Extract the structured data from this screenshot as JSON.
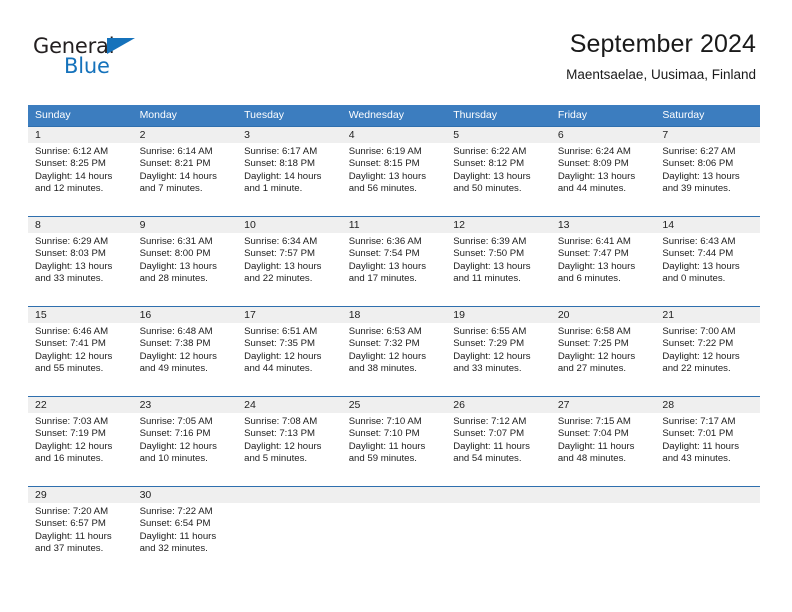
{
  "brand": {
    "word_one": "General",
    "word_two": "Blue",
    "accent_color": "#1572bb"
  },
  "header": {
    "title": "September 2024",
    "subtitle": "Maentsaelae, Uusimaa, Finland"
  },
  "calendar": {
    "header_bg": "#3c7dbf",
    "daynum_bg": "#efefef",
    "weekdays": [
      "Sunday",
      "Monday",
      "Tuesday",
      "Wednesday",
      "Thursday",
      "Friday",
      "Saturday"
    ],
    "weeks": [
      [
        {
          "day": "1",
          "sunrise": "Sunrise: 6:12 AM",
          "sunset": "Sunset: 8:25 PM",
          "daylight1": "Daylight: 14 hours",
          "daylight2": "and 12 minutes."
        },
        {
          "day": "2",
          "sunrise": "Sunrise: 6:14 AM",
          "sunset": "Sunset: 8:21 PM",
          "daylight1": "Daylight: 14 hours",
          "daylight2": "and 7 minutes."
        },
        {
          "day": "3",
          "sunrise": "Sunrise: 6:17 AM",
          "sunset": "Sunset: 8:18 PM",
          "daylight1": "Daylight: 14 hours",
          "daylight2": "and 1 minute."
        },
        {
          "day": "4",
          "sunrise": "Sunrise: 6:19 AM",
          "sunset": "Sunset: 8:15 PM",
          "daylight1": "Daylight: 13 hours",
          "daylight2": "and 56 minutes."
        },
        {
          "day": "5",
          "sunrise": "Sunrise: 6:22 AM",
          "sunset": "Sunset: 8:12 PM",
          "daylight1": "Daylight: 13 hours",
          "daylight2": "and 50 minutes."
        },
        {
          "day": "6",
          "sunrise": "Sunrise: 6:24 AM",
          "sunset": "Sunset: 8:09 PM",
          "daylight1": "Daylight: 13 hours",
          "daylight2": "and 44 minutes."
        },
        {
          "day": "7",
          "sunrise": "Sunrise: 6:27 AM",
          "sunset": "Sunset: 8:06 PM",
          "daylight1": "Daylight: 13 hours",
          "daylight2": "and 39 minutes."
        }
      ],
      [
        {
          "day": "8",
          "sunrise": "Sunrise: 6:29 AM",
          "sunset": "Sunset: 8:03 PM",
          "daylight1": "Daylight: 13 hours",
          "daylight2": "and 33 minutes."
        },
        {
          "day": "9",
          "sunrise": "Sunrise: 6:31 AM",
          "sunset": "Sunset: 8:00 PM",
          "daylight1": "Daylight: 13 hours",
          "daylight2": "and 28 minutes."
        },
        {
          "day": "10",
          "sunrise": "Sunrise: 6:34 AM",
          "sunset": "Sunset: 7:57 PM",
          "daylight1": "Daylight: 13 hours",
          "daylight2": "and 22 minutes."
        },
        {
          "day": "11",
          "sunrise": "Sunrise: 6:36 AM",
          "sunset": "Sunset: 7:54 PM",
          "daylight1": "Daylight: 13 hours",
          "daylight2": "and 17 minutes."
        },
        {
          "day": "12",
          "sunrise": "Sunrise: 6:39 AM",
          "sunset": "Sunset: 7:50 PM",
          "daylight1": "Daylight: 13 hours",
          "daylight2": "and 11 minutes."
        },
        {
          "day": "13",
          "sunrise": "Sunrise: 6:41 AM",
          "sunset": "Sunset: 7:47 PM",
          "daylight1": "Daylight: 13 hours",
          "daylight2": "and 6 minutes."
        },
        {
          "day": "14",
          "sunrise": "Sunrise: 6:43 AM",
          "sunset": "Sunset: 7:44 PM",
          "daylight1": "Daylight: 13 hours",
          "daylight2": "and 0 minutes."
        }
      ],
      [
        {
          "day": "15",
          "sunrise": "Sunrise: 6:46 AM",
          "sunset": "Sunset: 7:41 PM",
          "daylight1": "Daylight: 12 hours",
          "daylight2": "and 55 minutes."
        },
        {
          "day": "16",
          "sunrise": "Sunrise: 6:48 AM",
          "sunset": "Sunset: 7:38 PM",
          "daylight1": "Daylight: 12 hours",
          "daylight2": "and 49 minutes."
        },
        {
          "day": "17",
          "sunrise": "Sunrise: 6:51 AM",
          "sunset": "Sunset: 7:35 PM",
          "daylight1": "Daylight: 12 hours",
          "daylight2": "and 44 minutes."
        },
        {
          "day": "18",
          "sunrise": "Sunrise: 6:53 AM",
          "sunset": "Sunset: 7:32 PM",
          "daylight1": "Daylight: 12 hours",
          "daylight2": "and 38 minutes."
        },
        {
          "day": "19",
          "sunrise": "Sunrise: 6:55 AM",
          "sunset": "Sunset: 7:29 PM",
          "daylight1": "Daylight: 12 hours",
          "daylight2": "and 33 minutes."
        },
        {
          "day": "20",
          "sunrise": "Sunrise: 6:58 AM",
          "sunset": "Sunset: 7:25 PM",
          "daylight1": "Daylight: 12 hours",
          "daylight2": "and 27 minutes."
        },
        {
          "day": "21",
          "sunrise": "Sunrise: 7:00 AM",
          "sunset": "Sunset: 7:22 PM",
          "daylight1": "Daylight: 12 hours",
          "daylight2": "and 22 minutes."
        }
      ],
      [
        {
          "day": "22",
          "sunrise": "Sunrise: 7:03 AM",
          "sunset": "Sunset: 7:19 PM",
          "daylight1": "Daylight: 12 hours",
          "daylight2": "and 16 minutes."
        },
        {
          "day": "23",
          "sunrise": "Sunrise: 7:05 AM",
          "sunset": "Sunset: 7:16 PM",
          "daylight1": "Daylight: 12 hours",
          "daylight2": "and 10 minutes."
        },
        {
          "day": "24",
          "sunrise": "Sunrise: 7:08 AM",
          "sunset": "Sunset: 7:13 PM",
          "daylight1": "Daylight: 12 hours",
          "daylight2": "and 5 minutes."
        },
        {
          "day": "25",
          "sunrise": "Sunrise: 7:10 AM",
          "sunset": "Sunset: 7:10 PM",
          "daylight1": "Daylight: 11 hours",
          "daylight2": "and 59 minutes."
        },
        {
          "day": "26",
          "sunrise": "Sunrise: 7:12 AM",
          "sunset": "Sunset: 7:07 PM",
          "daylight1": "Daylight: 11 hours",
          "daylight2": "and 54 minutes."
        },
        {
          "day": "27",
          "sunrise": "Sunrise: 7:15 AM",
          "sunset": "Sunset: 7:04 PM",
          "daylight1": "Daylight: 11 hours",
          "daylight2": "and 48 minutes."
        },
        {
          "day": "28",
          "sunrise": "Sunrise: 7:17 AM",
          "sunset": "Sunset: 7:01 PM",
          "daylight1": "Daylight: 11 hours",
          "daylight2": "and 43 minutes."
        }
      ],
      [
        {
          "day": "29",
          "sunrise": "Sunrise: 7:20 AM",
          "sunset": "Sunset: 6:57 PM",
          "daylight1": "Daylight: 11 hours",
          "daylight2": "and 37 minutes."
        },
        {
          "day": "30",
          "sunrise": "Sunrise: 7:22 AM",
          "sunset": "Sunset: 6:54 PM",
          "daylight1": "Daylight: 11 hours",
          "daylight2": "and 32 minutes."
        },
        {
          "day": "",
          "sunrise": "",
          "sunset": "",
          "daylight1": "",
          "daylight2": ""
        },
        {
          "day": "",
          "sunrise": "",
          "sunset": "",
          "daylight1": "",
          "daylight2": ""
        },
        {
          "day": "",
          "sunrise": "",
          "sunset": "",
          "daylight1": "",
          "daylight2": ""
        },
        {
          "day": "",
          "sunrise": "",
          "sunset": "",
          "daylight1": "",
          "daylight2": ""
        },
        {
          "day": "",
          "sunrise": "",
          "sunset": "",
          "daylight1": "",
          "daylight2": ""
        }
      ]
    ]
  }
}
